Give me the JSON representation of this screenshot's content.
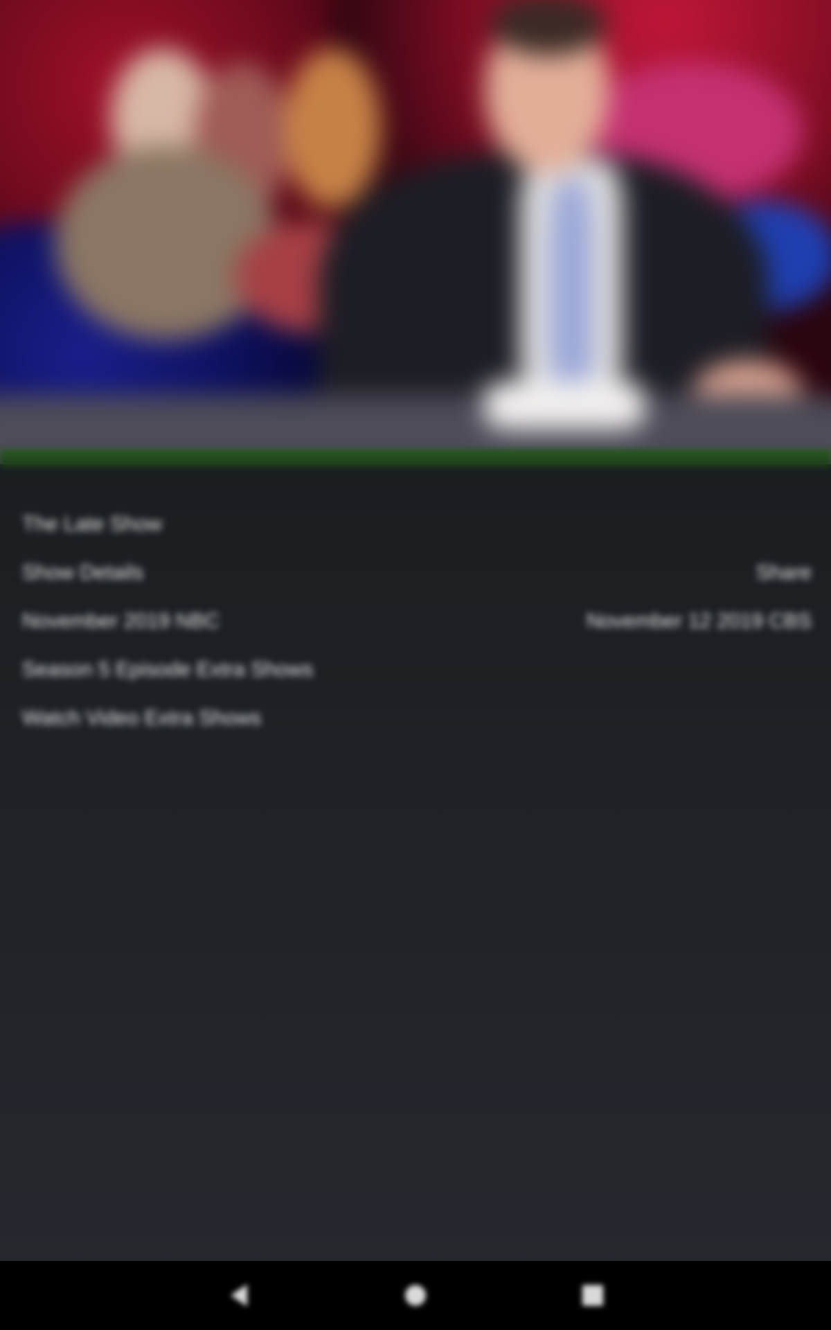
{
  "thumbnail": {
    "icon": "video-thumbnail"
  },
  "info_rows": [
    {
      "left": "The Late Show",
      "right": ""
    },
    {
      "left": "Show Details",
      "right": "Share"
    },
    {
      "left": "November 2019 NBC",
      "right": "November 12 2019 CBS"
    },
    {
      "left": "Season 5 Episode Extra Shows",
      "right": ""
    },
    {
      "left": "Watch Video Extra Shows",
      "right": ""
    }
  ],
  "navigation": {
    "back_icon": "back-icon",
    "home_icon": "home-icon",
    "recent_icon": "recent-apps-icon"
  },
  "colors": {
    "background": "#1b1f22",
    "text": "#e9eaec",
    "nav_bar": "#000000",
    "accent_strip": "#2b5b22"
  }
}
